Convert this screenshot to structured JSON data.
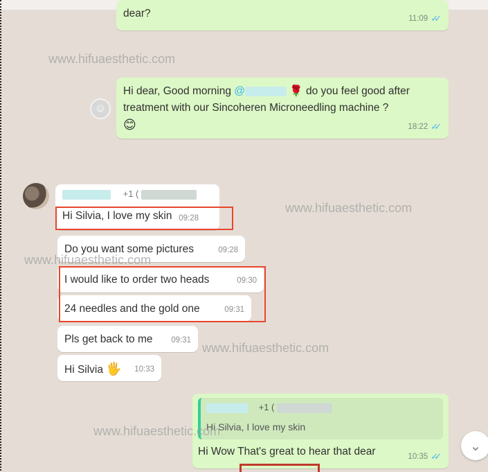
{
  "watermark": "www.hifuaesthetic.com",
  "messages": {
    "m1": {
      "text": "dear?",
      "time": "11:09"
    },
    "m2": {
      "greeting": "Hi dear, Good morning",
      "mention": "@",
      "rose": "🌹",
      "rest_line1": "do you feel good after",
      "line2": "treatment with our Sincoheren Microneedling machine ?",
      "emoji": "😊",
      "time": "18:22"
    },
    "sender_tag": "+1 (",
    "in1": {
      "text": "Hi Silvia, I love my skin",
      "time": "09:28"
    },
    "in2": {
      "text": "Do you want some pictures",
      "time": "09:28"
    },
    "in3": {
      "text": "I would like to order two heads",
      "time": "09:30"
    },
    "in4": {
      "text": "24 needles and the gold one",
      "time": "09:31"
    },
    "in5": {
      "text": "Pls get back to me",
      "time": "09:31"
    },
    "in6": {
      "text": "Hi Silvia",
      "emoji": "🖐",
      "time": "10:33"
    },
    "out_reply": {
      "quote_tag": "+1 (",
      "quote_text": "Hi Silvia, I love my skin",
      "text": "Hi Wow That's great to hear that dear",
      "time": "10:35"
    }
  },
  "icons": {
    "read_ticks": "double-check-icon",
    "scroll_down": "chevron-down-icon",
    "emoji_button": "emoji-icon"
  },
  "colors": {
    "outgoing": "#dcf8c6",
    "incoming": "#ffffff",
    "highlight": "#e8452c",
    "ticks": "#4fb6ec"
  }
}
